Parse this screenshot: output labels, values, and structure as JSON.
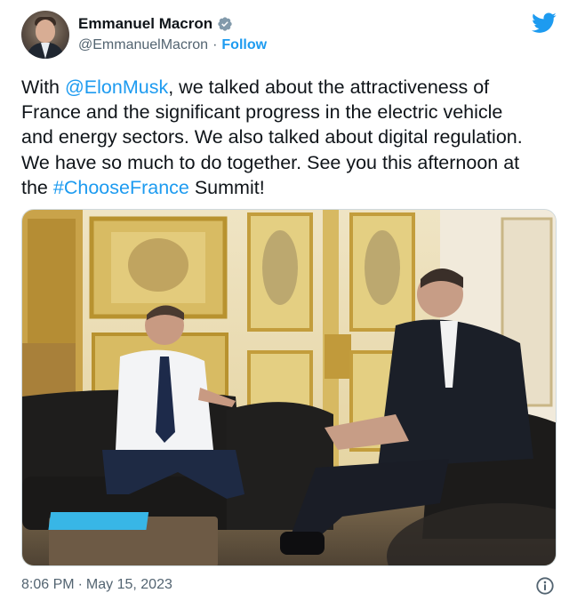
{
  "author": {
    "display_name": "Emmanuel Macron",
    "handle": "@EmmanuelMacron",
    "separator": "·",
    "follow_label": "Follow",
    "verified": true
  },
  "tweet": {
    "lines": [
      [
        {
          "text": "With ",
          "link": false
        },
        {
          "text": "@ElonMusk",
          "link": true
        },
        {
          "text": ", we talked about the attractiveness of",
          "link": false
        }
      ],
      [
        {
          "text": "France and the significant progress in the electric vehicle",
          "link": false
        }
      ],
      [
        {
          "text": "and energy sectors. We also talked about digital regulation.",
          "link": false
        }
      ],
      [
        {
          "text": "We have so much to do together. See you this afternoon at",
          "link": false
        }
      ],
      [
        {
          "text": "the ",
          "link": false
        },
        {
          "text": "#ChooseFrance",
          "link": true
        },
        {
          "text": " Summit!",
          "link": false
        }
      ]
    ]
  },
  "footer": {
    "time": "8:06 PM",
    "separator": "·",
    "date": "May 15, 2023"
  },
  "icons": {
    "bird": "twitter-bird-icon",
    "verified": "verified-badge-icon",
    "info": "info-icon"
  },
  "colors": {
    "link": "#1d9bf0",
    "text": "#0f1419",
    "muted": "#536471",
    "verified_badge": "#829aab"
  }
}
